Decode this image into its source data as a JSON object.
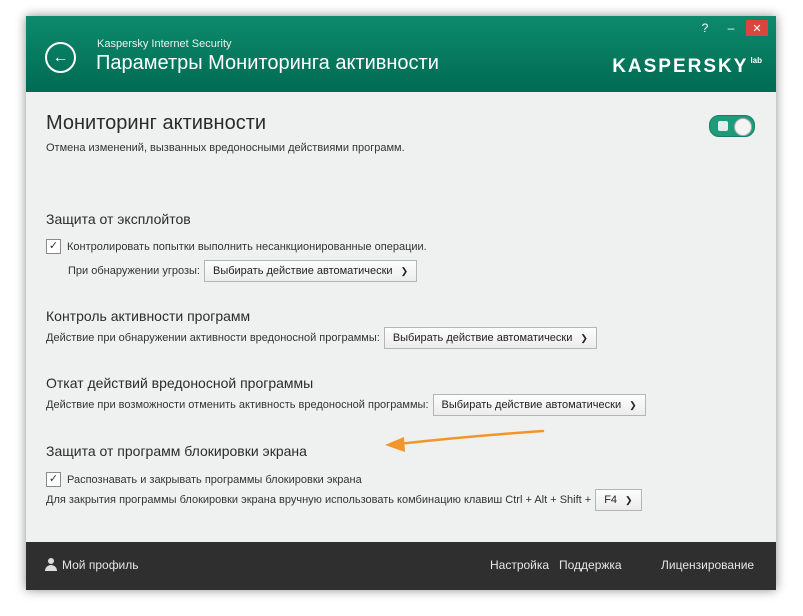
{
  "window": {
    "app_name": "Kaspersky Internet Security",
    "page_title": "Параметры Мониторинга активности",
    "help_label": "?",
    "minimize_label": "–",
    "close_label": "✕",
    "brand": "KASPERSKY",
    "brand_suffix": "lab"
  },
  "main": {
    "title": "Мониторинг активности",
    "subtitle": "Отмена изменений, вызванных вредоносными действиями программ.",
    "toggle_on": true
  },
  "sections": {
    "exploit": {
      "header": "Защита от эксплойтов",
      "checkbox_label": "Контролировать попытки выполнить несанкционированные операции.",
      "checkbox_checked": true,
      "dropdown_label": "При обнаружении угрозы:",
      "dropdown_value": "Выбирать действие автоматически"
    },
    "activity": {
      "header": "Контроль активности программ",
      "dropdown_label": "Действие при обнаружении активности вредоносной программы:",
      "dropdown_value": "Выбирать действие автоматически"
    },
    "rollback": {
      "header": "Откат действий вредоносной программы",
      "dropdown_label": "Действие при возможности отменить активность вредоносной программы:",
      "dropdown_value": "Выбирать действие автоматически"
    },
    "screenlock": {
      "header": "Защита от программ блокировки экрана",
      "checkbox_label": "Распознавать и закрывать программы блокировки экрана",
      "checkbox_checked": true,
      "combo_label": "Для закрытия программы блокировки экрана вручную использовать комбинацию клавиш Ctrl + Alt + Shift +",
      "combo_value": "F4"
    }
  },
  "footer": {
    "profile": "Мой профиль",
    "settings": "Настройка",
    "support": "Поддержка",
    "licensing": "Лицензирование"
  },
  "icons": {
    "back": "back-arrow-icon",
    "check": "checkmark-icon",
    "chevron": "chevron-down-icon",
    "user": "user-icon"
  },
  "colors": {
    "brand_green": "#00735a",
    "toggle_green": "#1e9b7a",
    "footer_bg": "#2f2f2f",
    "annotation_arrow": "#f0962a"
  }
}
